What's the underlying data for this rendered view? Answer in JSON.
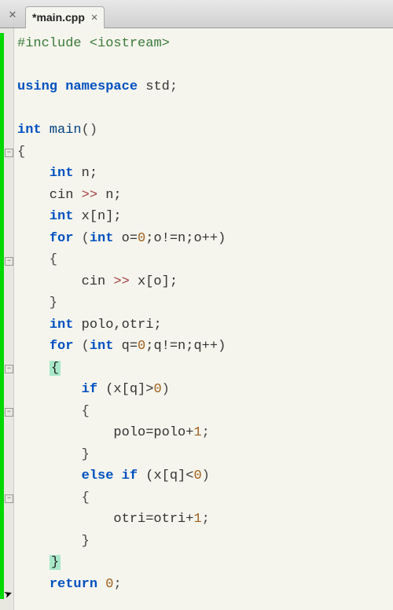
{
  "tabs": {
    "active": {
      "title": "*main.cpp",
      "close_glyph": "✕"
    },
    "prev_close_glyph": "✕"
  },
  "code": {
    "l1_include": "#include",
    "l1_lib": " <iostream>",
    "l3_using": "using",
    "l3_namespace": " namespace",
    "l3_std": " std",
    "l3_semi": ";",
    "l5_int": "int",
    "l5_main": " main",
    "l5_paren": "()",
    "l6_brace": "{",
    "l7_int": "int",
    "l7_rest": " n;",
    "l8_cin": "    cin ",
    "l8_op": ">>",
    "l8_rest": " n;",
    "l9_int": "int",
    "l9_rest": " x[n];",
    "l10_for": "for",
    "l10_paren": " (",
    "l10_int": "int",
    "l10_o": " o=",
    "l10_zero": "0",
    "l10_rest": ";o!=n;o++)",
    "l11_brace": "    {",
    "l12_cin": "        cin ",
    "l12_op": ">>",
    "l12_rest": " x[o];",
    "l13_brace": "    }",
    "l14_int": "int",
    "l14_rest": " polo,otri;",
    "l15_for": "for",
    "l15_paren": " (",
    "l15_int": "int",
    "l15_q": " q=",
    "l15_zero": "0",
    "l15_rest": ";q!=n;q++)",
    "l16_brace": "{",
    "l17_if": "if",
    "l17_rest": " (x[q]>",
    "l17_zero": "0",
    "l17_close": ")",
    "l18_brace": "        {",
    "l19_rest": "            polo=polo+",
    "l19_one": "1",
    "l19_semi": ";",
    "l20_brace": "        }",
    "l21_else": "else if",
    "l21_rest": " (x[q]<",
    "l21_zero": "0",
    "l21_close": ")",
    "l22_brace": "        {",
    "l23_rest": "            otri=otri+",
    "l23_one": "1",
    "l23_semi": ";",
    "l24_brace": "        }",
    "l25_brace": "}",
    "l26_return": "return",
    "l26_sp": " ",
    "l26_zero": "0",
    "l26_semi": ";"
  },
  "fold": {
    "minus": "−"
  }
}
